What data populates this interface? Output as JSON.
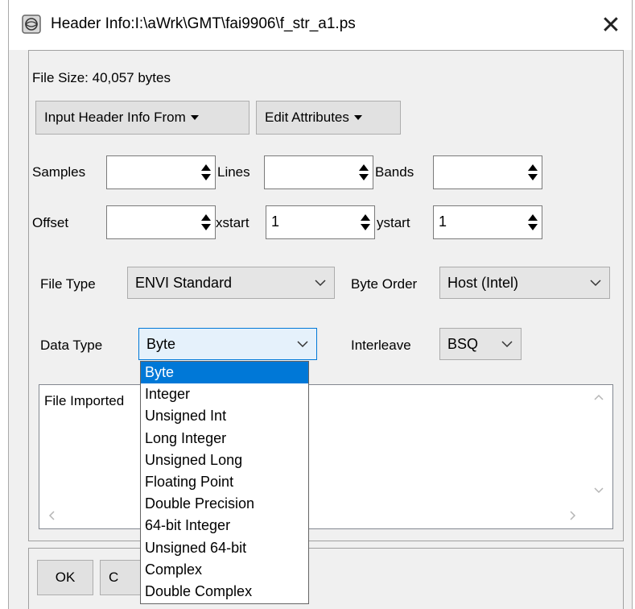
{
  "window": {
    "title": "Header Info:I:\\aWrk\\GMT\\fai9906\\f_str_a1.ps",
    "close_glyph": "✕"
  },
  "file_size": "File Size: 40,057 bytes",
  "toolbar": {
    "input_header_label": "Input Header Info From",
    "edit_attributes_label": "Edit Attributes"
  },
  "fields": {
    "samples": {
      "label": "Samples",
      "value": ""
    },
    "lines": {
      "label": "Lines",
      "value": ""
    },
    "bands": {
      "label": "Bands",
      "value": ""
    },
    "offset": {
      "label": "Offset",
      "value": ""
    },
    "xstart": {
      "label": "xstart",
      "value": "1"
    },
    "ystart": {
      "label": "ystart",
      "value": "1"
    }
  },
  "file_type": {
    "label": "File Type",
    "value": "ENVI Standard"
  },
  "byte_order": {
    "label": "Byte Order",
    "value": "Host (Intel)"
  },
  "data_type": {
    "label": "Data Type",
    "value": "Byte"
  },
  "interleave": {
    "label": "Interleave",
    "value": "BSQ"
  },
  "log": {
    "text": "File Imported"
  },
  "buttons": {
    "ok": "OK",
    "cancel_partial": "C"
  },
  "data_type_options": [
    "Byte",
    "Integer",
    "Unsigned Int",
    "Long Integer",
    "Unsigned Long",
    "Floating Point",
    "Double Precision",
    "64-bit Integer",
    "Unsigned 64-bit",
    "Complex",
    "Double Complex"
  ],
  "colors": {
    "selection": "#0078d7",
    "window_bg": "#f0f0f0"
  }
}
